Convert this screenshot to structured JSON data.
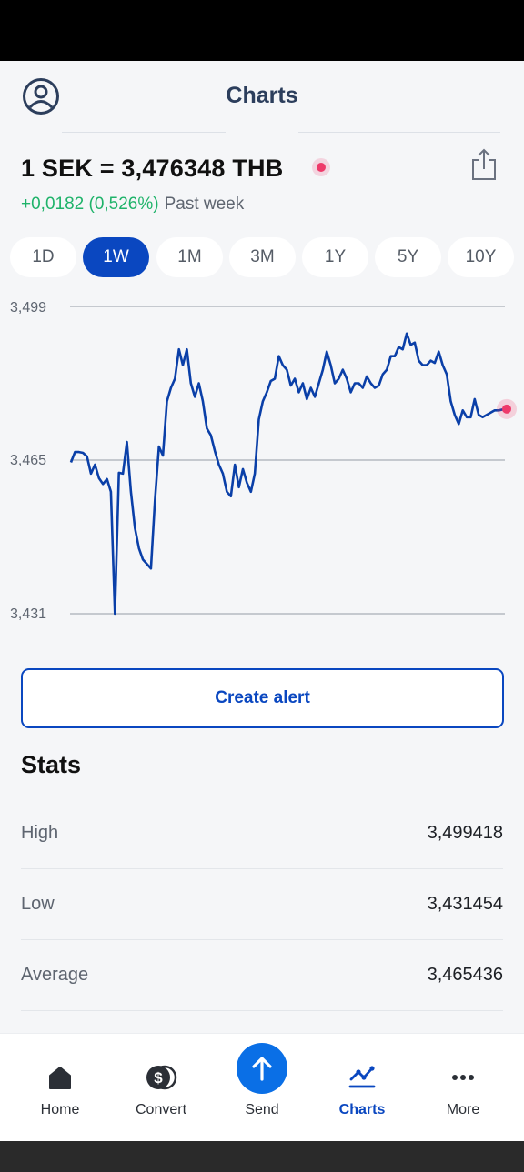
{
  "header": {
    "title": "Charts"
  },
  "rate": {
    "label": "1 SEK = 3,476348 THB",
    "change": "+0,0182 (0,526%)",
    "period": "Past week"
  },
  "range_tabs": [
    {
      "label": "1D"
    },
    {
      "label": "1W",
      "active": true
    },
    {
      "label": "1M"
    },
    {
      "label": "3M"
    },
    {
      "label": "1Y"
    },
    {
      "label": "5Y"
    },
    {
      "label": "10Y"
    }
  ],
  "chart_data": {
    "type": "line",
    "y_ticks": [
      "3,499",
      "3,465",
      "3,431"
    ],
    "ylim": [
      3.431,
      3.499
    ],
    "grid": true,
    "line_color": "#0a3fa8",
    "marker_color": "#ee3a6a",
    "series": [
      {
        "values": [
          3.4645,
          3.4668,
          3.4668,
          3.4666,
          3.4658,
          3.462,
          3.464,
          3.461,
          3.4597,
          3.4608,
          3.458,
          3.431,
          3.4622,
          3.462,
          3.469,
          3.458,
          3.45,
          3.4455,
          3.443,
          3.442,
          3.441,
          3.456,
          3.468,
          3.466,
          3.478,
          3.481,
          3.483,
          3.4895,
          3.486,
          3.4895,
          3.482,
          3.479,
          3.482,
          3.478,
          3.472,
          3.4705,
          3.467,
          3.464,
          3.462,
          3.458,
          3.457,
          3.464,
          3.459,
          3.463,
          3.46,
          3.458,
          3.462,
          3.474,
          3.478,
          3.48,
          3.4825,
          3.483,
          3.488,
          3.486,
          3.485,
          3.4815,
          3.483,
          3.48,
          3.482,
          3.4785,
          3.481,
          3.479,
          3.482,
          3.485,
          3.489,
          3.486,
          3.482,
          3.483,
          3.485,
          3.483,
          3.48,
          3.482,
          3.482,
          3.481,
          3.4835,
          3.482,
          3.481,
          3.4815,
          3.484,
          3.485,
          3.488,
          3.488,
          3.49,
          3.4895,
          3.493,
          3.4905,
          3.491,
          3.487,
          3.486,
          3.486,
          3.487,
          3.4865,
          3.489,
          3.486,
          3.484,
          3.478,
          3.475,
          3.473,
          3.476,
          3.4745,
          3.4745,
          3.4785,
          3.475,
          3.4745,
          3.475,
          3.4755,
          3.476,
          3.476,
          3.4762,
          3.4763
        ]
      }
    ]
  },
  "create_alert": {
    "label": "Create alert"
  },
  "stats": {
    "title": "Stats",
    "rows": [
      {
        "label": "High",
        "value": "3,499418"
      },
      {
        "label": "Low",
        "value": "3,431454"
      },
      {
        "label": "Average",
        "value": "3,465436"
      }
    ]
  },
  "bottom_nav": [
    {
      "label": "Home",
      "icon": "home-icon"
    },
    {
      "label": "Convert",
      "icon": "convert-icon"
    },
    {
      "label": "Send",
      "icon": "send-icon"
    },
    {
      "label": "Charts",
      "icon": "charts-icon",
      "active": true
    },
    {
      "label": "More",
      "icon": "more-icon"
    }
  ]
}
